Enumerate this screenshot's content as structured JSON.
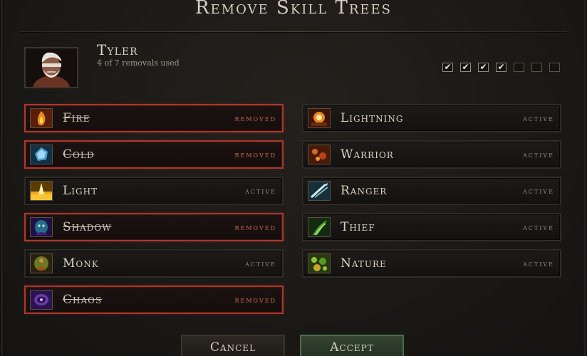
{
  "dialog": {
    "title": "Remove Skill Trees"
  },
  "character": {
    "name": "Tyler",
    "removals_text": "4 of 7 removals used",
    "removal_slots": [
      true,
      true,
      true,
      true,
      false,
      false,
      false
    ],
    "checkmark": "✔"
  },
  "skills_left": [
    {
      "name": "Fire",
      "status": "removed",
      "icon": "fire-icon"
    },
    {
      "name": "Cold",
      "status": "removed",
      "icon": "cold-icon"
    },
    {
      "name": "Light",
      "status": "active",
      "icon": "light-icon"
    },
    {
      "name": "Shadow",
      "status": "removed",
      "icon": "shadow-icon"
    },
    {
      "name": "Monk",
      "status": "active",
      "icon": "monk-icon"
    },
    {
      "name": "Chaos",
      "status": "removed",
      "icon": "chaos-icon"
    }
  ],
  "skills_right": [
    {
      "name": "Lightning",
      "status": "active",
      "icon": "lightning-icon"
    },
    {
      "name": "Warrior",
      "status": "active",
      "icon": "warrior-icon"
    },
    {
      "name": "Ranger",
      "status": "active",
      "icon": "ranger-icon"
    },
    {
      "name": "Thief",
      "status": "active",
      "icon": "thief-icon"
    },
    {
      "name": "Nature",
      "status": "active",
      "icon": "nature-icon"
    }
  ],
  "buttons": {
    "cancel": "Cancel",
    "accept": "Accept"
  },
  "colors": {
    "removed_border": "#a8382e",
    "removed_text": "#c9684f",
    "accept_button": "#354632"
  }
}
